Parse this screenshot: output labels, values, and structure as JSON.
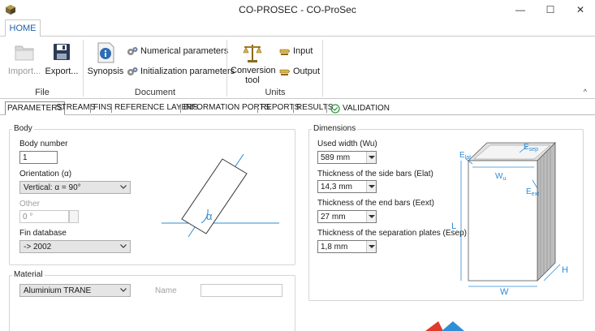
{
  "window": {
    "title": "CO-PROSEC - CO-ProSec",
    "minimize": "—",
    "maximize": "☐",
    "close": "✕"
  },
  "ribbon": {
    "tab_home": "HOME",
    "file": {
      "label": "File",
      "import": "Import...",
      "export": "Export..."
    },
    "document": {
      "label": "Document",
      "synopsis": "Synopsis",
      "numerical": "Numerical parameters",
      "initialization": "Initialization parameters"
    },
    "units": {
      "label": "Units",
      "conversion_line1": "Conversion",
      "conversion_line2": "tool",
      "input": "Input",
      "output": "Output"
    },
    "collapse": "^"
  },
  "tabs": [
    "PARAMETERS",
    "STREAMS",
    "FINS",
    "REFERENCE LAYERS",
    "INFORMATION PORTS",
    "REPORTS",
    "RESULTS",
    "VALIDATION"
  ],
  "body": {
    "title": "Body",
    "body_number_label": "Body number",
    "body_number_value": "1",
    "orientation_label": "Orientation (α)",
    "orientation_value": "Vertical: α = 90°",
    "other_label": "Other",
    "other_value": "0 °",
    "fin_db_label": "Fin database",
    "fin_db_value": "-> 2002",
    "alpha_symbol": "α"
  },
  "material": {
    "title": "Material",
    "value": "Aluminium TRANE",
    "name_label": "Name",
    "name_value": ""
  },
  "dimensions": {
    "title": "Dimensions",
    "wu_label": "Used width (Wu)",
    "wu_value": "589 mm",
    "elat_label": "Thickness of the side bars (Elat)",
    "elat_value": "14,3 mm",
    "eext_label": "Thickness of the end bars (Eext)",
    "eext_value": "27 mm",
    "esep_label": "Thickness of the separation plates (Esep)",
    "esep_value": "1,8 mm",
    "diagram": {
      "e_lat_main": "E",
      "e_lat_sub": "lat",
      "e_sep_main": "E",
      "e_sep_sub": "sep",
      "w_u_main": "W",
      "w_u_sub": "u",
      "e_ext_main": "E",
      "e_ext_sub": "ext",
      "l": "L",
      "h": "H",
      "w": "W"
    }
  },
  "colors": {
    "accent_blue": "#1e5fa8",
    "dim_blue": "#2e8bd6",
    "validation_green": "#2f9e44"
  }
}
